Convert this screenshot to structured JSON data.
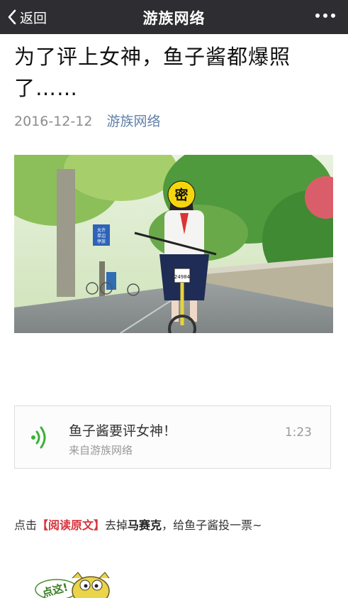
{
  "nav": {
    "back_label": "返回",
    "title": "游族网络"
  },
  "article": {
    "title": "为了评上女神，鱼子酱都爆照了……",
    "date": "2016-12-12",
    "source": "游族网络",
    "photo": {
      "face_badge": "密",
      "sign_text": [
        "允许",
        "单边",
        "停放"
      ],
      "bike_plate": "24984"
    }
  },
  "audio": {
    "title": "鱼子酱要评女神！",
    "subtitle": "来自游族网络",
    "duration": "1:23"
  },
  "paragraph": {
    "prefix": "点击",
    "highlight": "【阅读原文】",
    "middle": "去掉",
    "bold": "马赛克",
    "suffix": "，给鱼子酱投一票~"
  },
  "sticker": {
    "text": "点这!"
  },
  "colors": {
    "navbar": "#2e2e32",
    "link": "#607fa6",
    "highlight": "#d6333b",
    "audio_icon": "#3cb035"
  }
}
